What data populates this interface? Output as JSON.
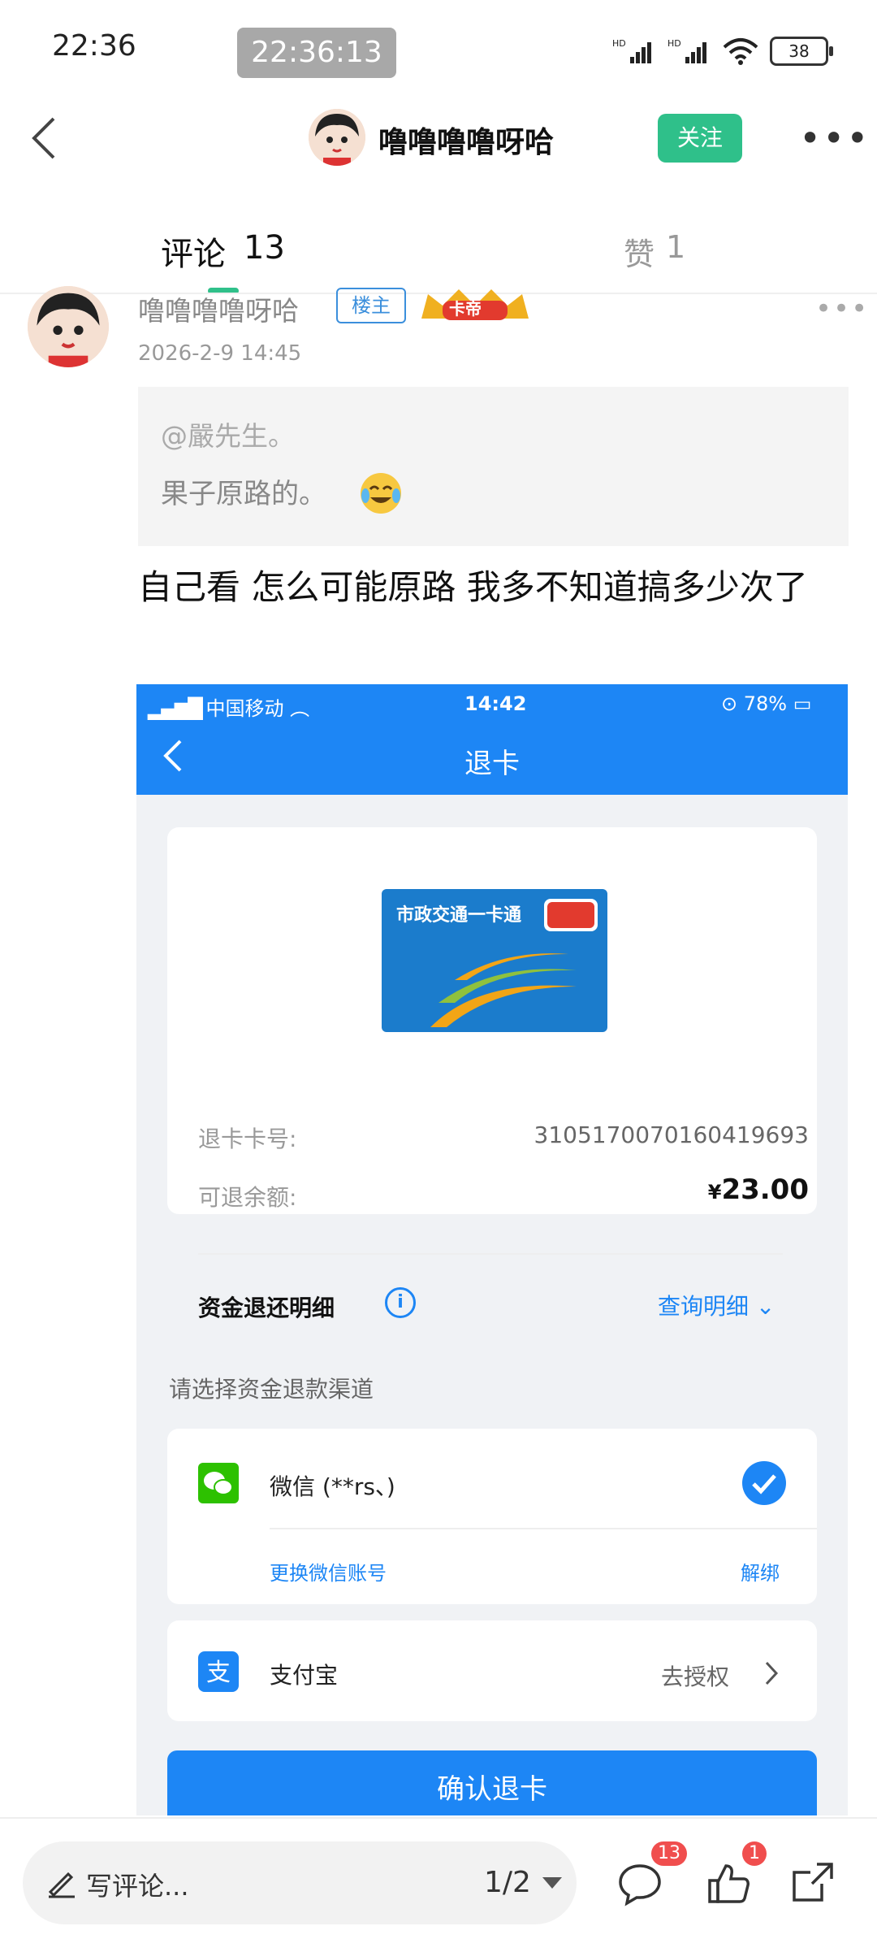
{
  "status_bar": {
    "time": "22:36",
    "recording_time": "22:36:13",
    "battery": "38"
  },
  "header": {
    "name": "噜噜噜噜呀哈",
    "follow_label": "关注"
  },
  "tabs": {
    "comments_label": "评论",
    "comments_count": "13",
    "likes_label": "赞",
    "likes_count": "1"
  },
  "post": {
    "author": "噜噜噜噜呀哈",
    "host_badge": "楼主",
    "crown_label": "卡帝",
    "date": "2026-2-9 14:45",
    "quote_mention": "@嚴先生。",
    "quote_text": "果子原路的。",
    "text": "自己看 怎么可能原路 我多不知道搞多少次了"
  },
  "screenshot": {
    "carrier": "中国移动",
    "time": "14:42",
    "battery": "78%",
    "title": "退卡",
    "card_brand": "市政交通一卡通",
    "card_number_label": "退卡卡号:",
    "card_number": "3105170070160419693",
    "refund_label": "可退余额:",
    "refund_currency": "¥",
    "refund_amount": "23.00",
    "detail_title": "资金退还明细",
    "detail_link": "查询明细",
    "channel_title": "请选择资金退款渠道",
    "wechat_label": "微信 (**rs、)",
    "wechat_change": "更换微信账号",
    "wechat_unbind": "解绑",
    "alipay_label": "支付宝",
    "alipay_action": "去授权",
    "confirm_label": "确认退卡"
  },
  "bottom_bar": {
    "comment_placeholder": "写评论...",
    "page_indicator": "1/2",
    "comment_badge": "13",
    "like_badge": "1"
  },
  "colors": {
    "accent_green": "#2fc08a",
    "alipay_blue": "#1d86f5",
    "badge_red": "#f04e4e"
  }
}
